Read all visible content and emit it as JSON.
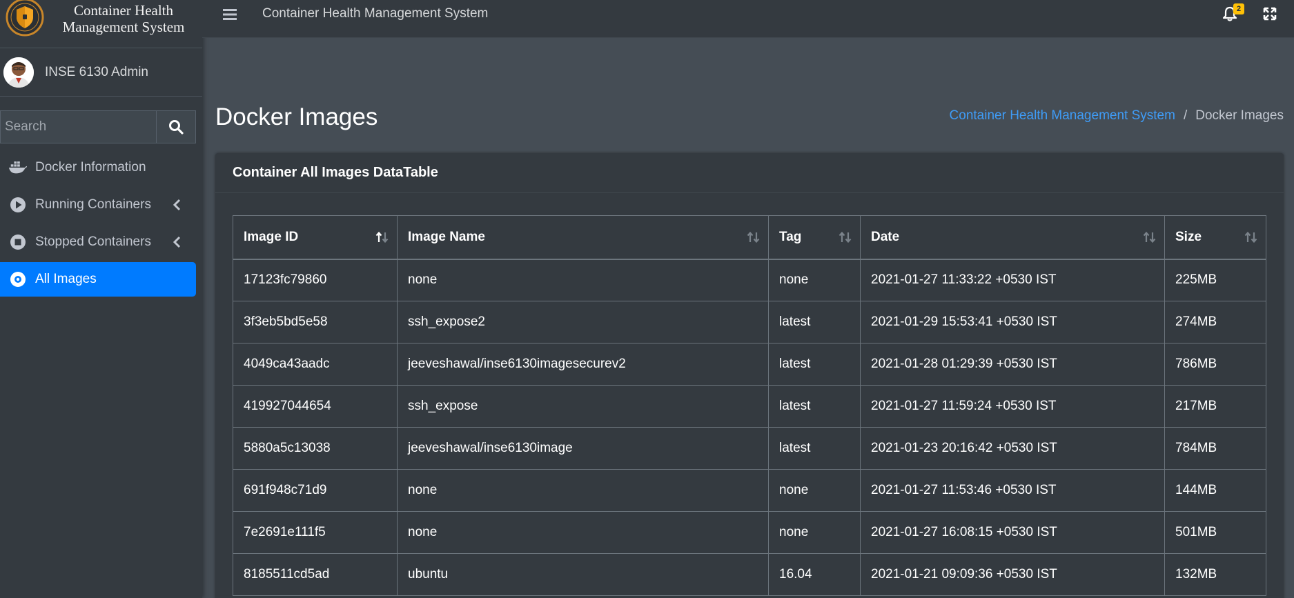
{
  "sidebar": {
    "brand": "Container Health Management System",
    "user_name": "INSE 6130 Admin",
    "search_placeholder": "Search",
    "items": [
      {
        "label": "Docker Information",
        "icon": "docker-icon"
      },
      {
        "label": "Running Containers",
        "icon": "play-circle-icon"
      },
      {
        "label": "Stopped Containers",
        "icon": "stop-circle-icon"
      },
      {
        "label": "All Images",
        "icon": "disc-icon"
      }
    ]
  },
  "topbar": {
    "title": "Container Health Management System",
    "notification_count": "2"
  },
  "page": {
    "title": "Docker Images",
    "breadcrumb": {
      "link": "Container Health Management System",
      "separator": "/",
      "current": "Docker Images"
    }
  },
  "card": {
    "title": "Container All Images DataTable"
  },
  "table": {
    "columns": [
      "Image ID",
      "Image Name",
      "Tag",
      "Date",
      "Size"
    ],
    "sort": {
      "column": "Image ID",
      "direction": "ascending"
    },
    "rows": [
      [
        "17123fc79860",
        "none",
        "none",
        "2021-01-27 11:33:22 +0530 IST",
        "225MB"
      ],
      [
        "3f3eb5bd5e58",
        "ssh_expose2",
        "latest",
        "2021-01-29 15:53:41 +0530 IST",
        "274MB"
      ],
      [
        "4049ca43aadc",
        "jeeveshawal/inse6130imagesecurev2",
        "latest",
        "2021-01-28 01:29:39 +0530 IST",
        "786MB"
      ],
      [
        "419927044654",
        "ssh_expose",
        "latest",
        "2021-01-27 11:59:24 +0530 IST",
        "217MB"
      ],
      [
        "5880a5c13038",
        "jeeveshawal/inse6130image",
        "latest",
        "2021-01-23 20:16:42 +0530 IST",
        "784MB"
      ],
      [
        "691f948c71d9",
        "none",
        "none",
        "2021-01-27 11:53:46 +0530 IST",
        "144MB"
      ],
      [
        "7e2691e111f5",
        "none",
        "none",
        "2021-01-27 16:08:15 +0530 IST",
        "501MB"
      ],
      [
        "8185511cd5ad",
        "ubuntu",
        "16.04",
        "2021-01-21 09:09:36 +0530 IST",
        "132MB"
      ]
    ]
  },
  "colors": {
    "sidebar_bg": "#343a40",
    "content_bg": "#454d55",
    "accent": "#007bff",
    "link": "#3f9cf7",
    "badge": "#ffc107"
  }
}
